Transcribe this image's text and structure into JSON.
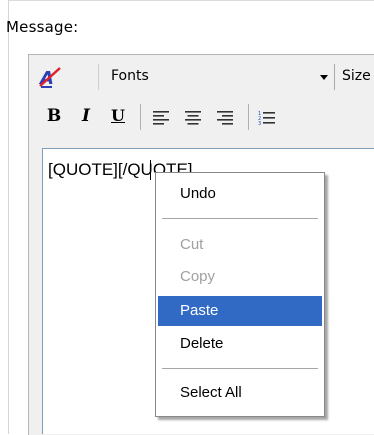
{
  "message_label": "Message:",
  "toolbar": {
    "font_select_value": "Fonts",
    "size_select_value": "Size",
    "bold": "B",
    "italic": "I",
    "underline": "U"
  },
  "editor": {
    "content": "[QUOTE][/QUOTE]"
  },
  "context_menu": {
    "undo": "Undo",
    "cut": "Cut",
    "copy": "Copy",
    "paste": "Paste",
    "delete": "Delete",
    "select_all": "Select All"
  },
  "colors": {
    "highlight": "#316ac5",
    "disabled_text": "#a0a0a0"
  }
}
